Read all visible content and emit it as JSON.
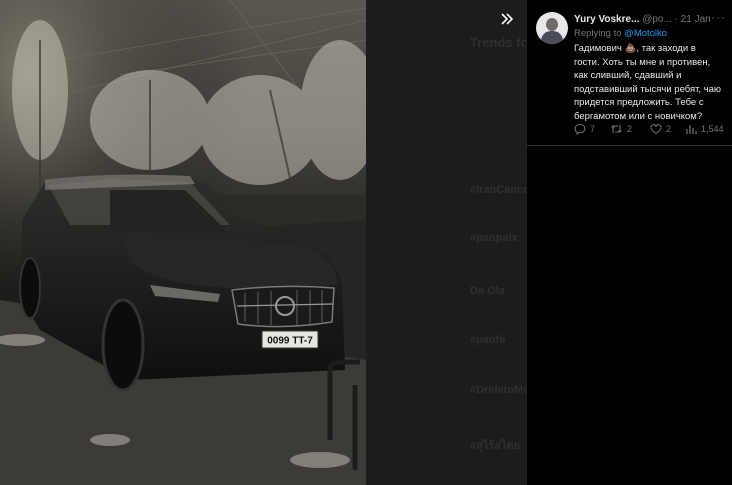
{
  "viewer": {
    "collapse_icon": "double-chevron-right-icon",
    "plate_text": "0099 TT-7",
    "background_trends": {
      "heading": "Trends fo",
      "items": [
        "#IranCanceLa",
        "#раорalx",
        "Da Ola",
        "#paofe",
        "#DreletoMe",
        "#สุไร้สไตย"
      ]
    }
  },
  "tweet": {
    "author_name": "Yury Voskre...",
    "handle": "@po...",
    "separator": "·",
    "date": "21 Jan",
    "more_icon": "more-dots-icon",
    "replying_prefix": "Replying to",
    "replying_to": "@Motolko",
    "text": "Гадимович 💩, так заходи в гости. Хоть ты мне и противен, как сливший, сдавший и подставивший тысячи ребят, чаю придется предложить. Тебе с бергамотом или с новичком?",
    "actions": {
      "reply_count": "7",
      "retweet_count": "2",
      "like_count": "2",
      "views_count": "1,544"
    }
  },
  "colors": {
    "accent": "#1d9bf0",
    "text_primary": "#e7e9ea",
    "text_secondary": "#71767b",
    "background": "#000000"
  }
}
